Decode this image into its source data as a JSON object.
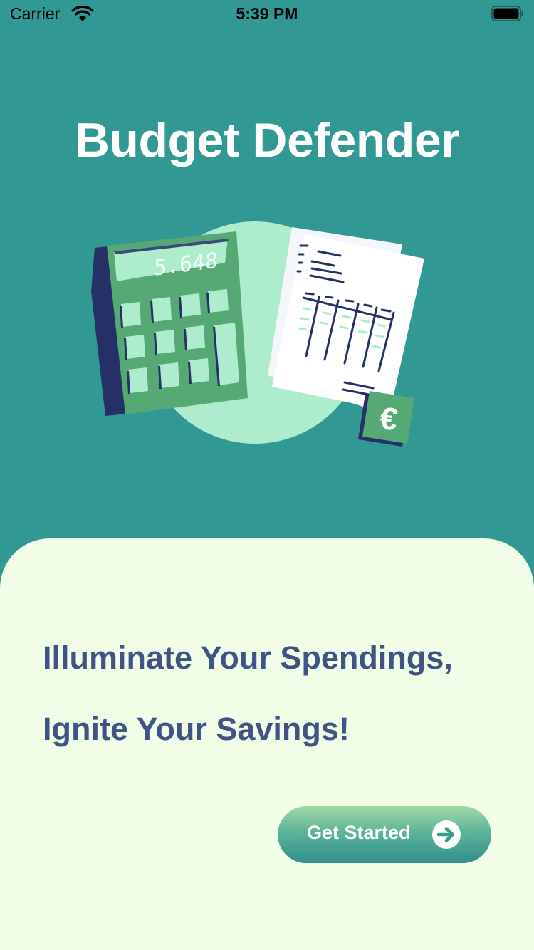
{
  "status_bar": {
    "carrier": "Carrier",
    "time": "5:39 PM",
    "icons": [
      "wifi-icon",
      "battery-icon"
    ]
  },
  "app": {
    "title": "Budget Defender"
  },
  "illustration": {
    "calculator_display": "5.648",
    "currency_symbol": "€"
  },
  "tagline": {
    "line1": "Illuminate Your Spendings,",
    "line2": "Ignite Your Savings!"
  },
  "cta": {
    "label": "Get Started",
    "icon": "arrow-right-circle-icon"
  },
  "colors": {
    "background": "#319894",
    "sheet": "#f2fde8",
    "tagline": "#3f5485",
    "calculator": "#56a874",
    "key": "#aeecce",
    "navy": "#253067"
  }
}
